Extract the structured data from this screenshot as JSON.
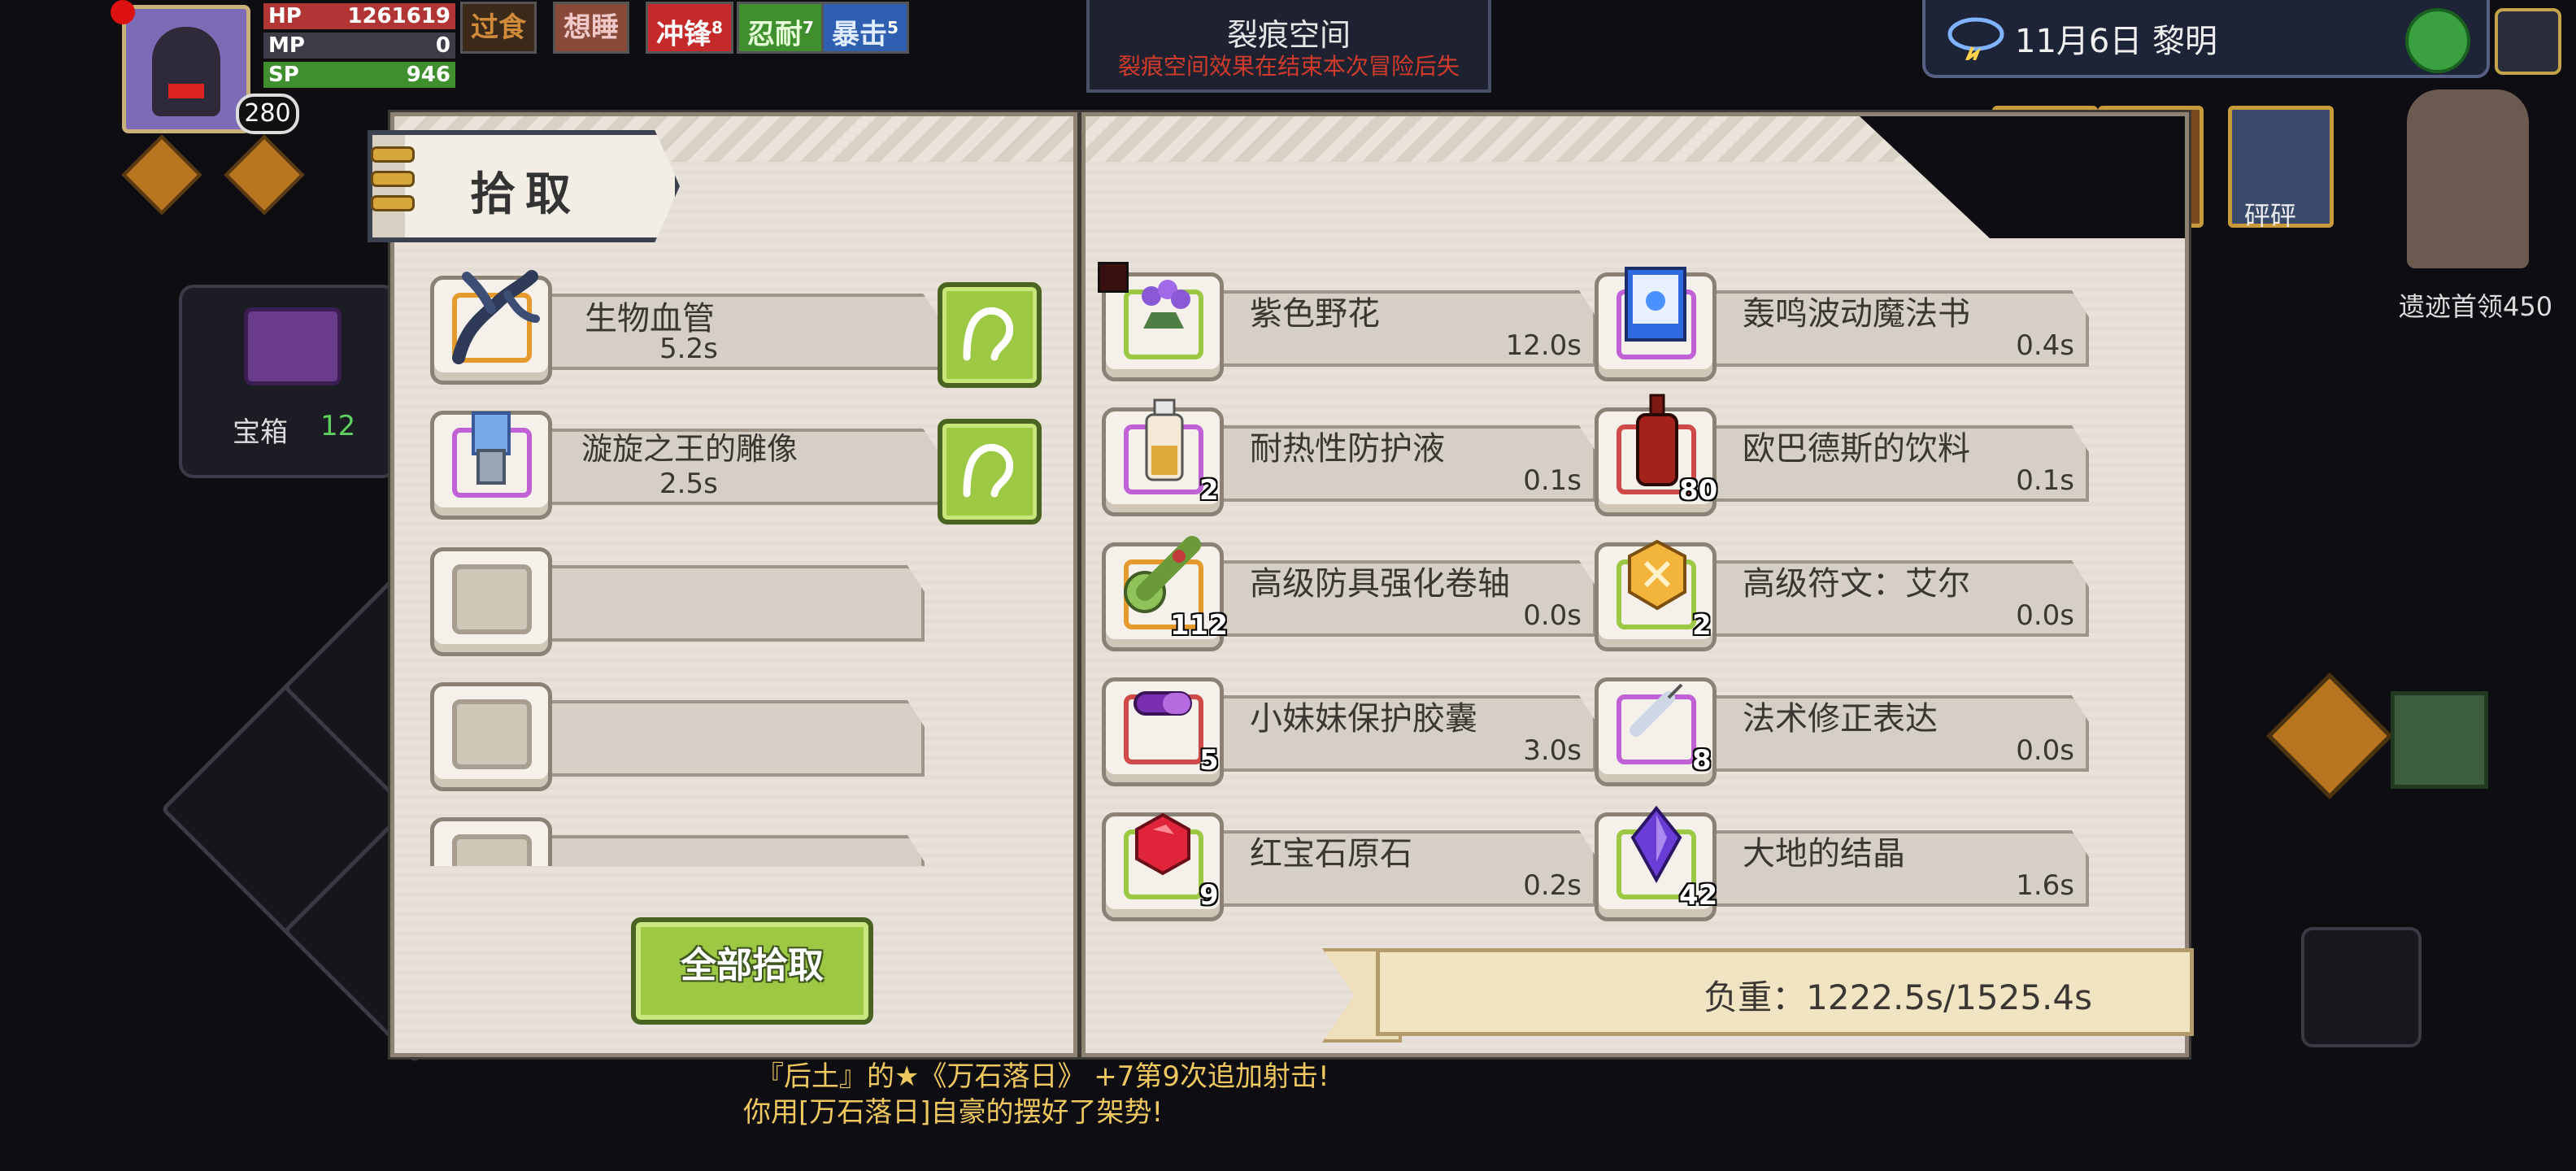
{
  "hud": {
    "level": "280",
    "stats": [
      {
        "label": "HP",
        "value": "1261619",
        "color": "#c73a3a"
      },
      {
        "label": "MP",
        "value": "0",
        "color": "#3a6fc7"
      },
      {
        "label": "SP",
        "value": "946",
        "color": "#4aa23a"
      }
    ],
    "buffs": [
      {
        "label": "过食",
        "sup": "",
        "color": "#c06a2a",
        "bg": "#3b2a1a"
      },
      {
        "label": "想睡",
        "sup": "",
        "color": "#e6c0c0",
        "bg": "#8a4a3a"
      },
      {
        "label": "冲锋",
        "sup": "8",
        "color": "#ffffff",
        "bg": "#c42a2a"
      },
      {
        "label": "忍耐",
        "sup": "7",
        "color": "#d9f5c9",
        "bg": "#3f8f2f"
      },
      {
        "label": "暴击",
        "sup": "5",
        "color": "#d6e6ff",
        "bg": "#2f5fb0"
      }
    ],
    "rift_title": "裂痕空间",
    "rift_subtitle": "裂痕空间效果在结束本次冒险后失",
    "date_text": "11月6日  黎明",
    "chest_label": "宝箱",
    "chest_count": "12",
    "minimap_label": "遗迹首领450",
    "top_right_label": "砰砰",
    "log_lines": [
      "『后土』的★《万石落日》 +7第9次追加射击!",
      "你用[万石落日]自豪的摆好了架势!"
    ]
  },
  "pickup_panel": {
    "title": "拾取",
    "items": [
      {
        "name": "生物血管",
        "time": "5.2s",
        "border": "#e59a2e",
        "icon": "vein-icon"
      },
      {
        "name": "漩旋之王的雕像",
        "time": "2.5s",
        "border": "#c061d6",
        "icon": "statue-icon"
      },
      {
        "name": "",
        "time": "",
        "border": "#a79d90",
        "icon": ""
      },
      {
        "name": "",
        "time": "",
        "border": "#a79d90",
        "icon": ""
      },
      {
        "name": "",
        "time": "",
        "border": "#a79d90",
        "icon": ""
      }
    ],
    "pick_all_label": "全部拾取"
  },
  "inventory_panel": {
    "items": [
      {
        "name": "紫色野花",
        "time": "12.0s",
        "count": "",
        "border": "#9cc843",
        "icon": "wildflower-icon"
      },
      {
        "name": "轰鸣波动魔法书",
        "time": "0.4s",
        "count": "",
        "border": "#c061d6",
        "icon": "spellbook-icon"
      },
      {
        "name": "耐热性防护液",
        "time": "0.1s",
        "count": "2",
        "border": "#c061d6",
        "icon": "potion-bottle-icon"
      },
      {
        "name": "欧巴德斯的饮料",
        "time": "0.1s",
        "count": "80",
        "border": "#d14a4a",
        "icon": "drink-bottle-icon"
      },
      {
        "name": "高级防具强化卷轴",
        "time": "0.0s",
        "count": "112",
        "border": "#e59a2e",
        "icon": "scroll-icon"
      },
      {
        "name": "高级符文：艾尔",
        "time": "0.0s",
        "count": "2",
        "border": "#9cc843",
        "icon": "rune-icon"
      },
      {
        "name": "小妹妹保护胶囊",
        "time": "3.0s",
        "count": "5",
        "border": "#d14a4a",
        "icon": "capsule-icon"
      },
      {
        "name": "法术修正表达",
        "time": "0.0s",
        "count": "8",
        "border": "#c061d6",
        "icon": "syringe-icon"
      },
      {
        "name": "红宝石原石",
        "time": "0.2s",
        "count": "9",
        "border": "#9cc843",
        "icon": "ruby-icon"
      },
      {
        "name": "大地的结晶",
        "time": "1.6s",
        "count": "42",
        "border": "#9cc843",
        "icon": "crystal-icon"
      }
    ],
    "weight_text": "负重：1222.5s/1525.4s"
  }
}
